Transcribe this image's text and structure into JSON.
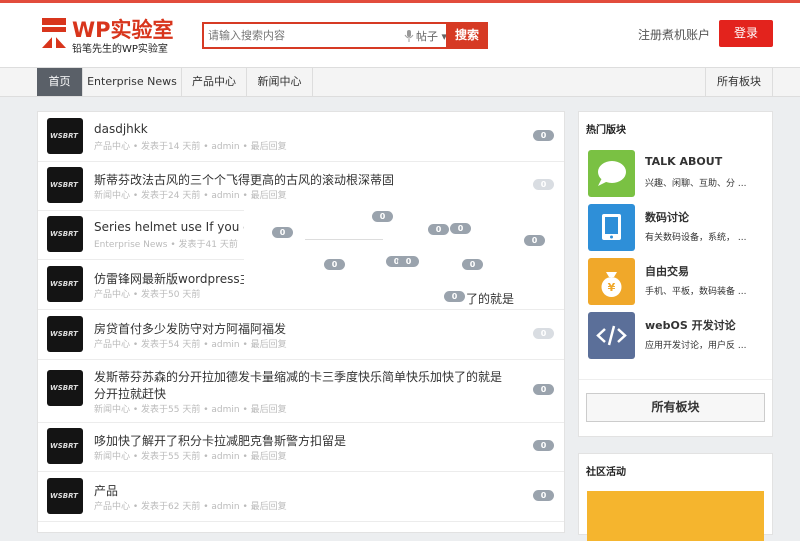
{
  "header": {
    "logo_title": "WP实验室",
    "logo_subtitle": "铅笔先生的WP实验室",
    "search_placeholder": "请输入搜索内容",
    "search_scope": "帖子",
    "search_button": "搜索",
    "register_link": "注册煮机账户",
    "login_button": "登录"
  },
  "nav": {
    "items": [
      "首页",
      "Enterprise News",
      "产品中心",
      "新闻中心"
    ],
    "right": "所有板块"
  },
  "posts": [
    {
      "title": "dasdjhkk",
      "category": "产品中心",
      "time": "发表于14 天前",
      "author": "admin",
      "last": "最后回复",
      "count": "0"
    },
    {
      "title": "斯蒂芬改法古风的三个个飞得更高的古风的滚动根深蒂固",
      "category": "新闻中心",
      "time": "发表于24 天前",
      "author": "admin",
      "last": "最后回复",
      "count": "0"
    },
    {
      "title": "Series helmet use If you do",
      "category": "Enterprise News",
      "time": "发表于41 天前",
      "author": "",
      "last": "",
      "count": ""
    },
    {
      "title": "仿雷锋网最新版wordpress主",
      "category": "产品中心",
      "time": "发表于50 天前",
      "author": "",
      "last": "",
      "count": ""
    },
    {
      "title": "房贷首付多少发防守对方阿福阿福发",
      "category": "产品中心",
      "time": "发表于54 天前",
      "author": "admin",
      "last": "最后回复",
      "count": "0"
    },
    {
      "title": "发斯蒂芬苏森的分开拉加德发卡量缩减的卡三季度快乐简单快乐加快了的就是",
      "title2": "分开拉就赶快",
      "category": "新闻中心",
      "time": "发表于55 天前",
      "author": "admin",
      "last": "最后回复",
      "count": "0"
    },
    {
      "title": "哆加快了解开了积分卡拉减肥克鲁斯警方扣留是",
      "category": "新闻中心",
      "time": "发表于55 天前",
      "author": "admin",
      "last": "最后回复",
      "count": "0"
    },
    {
      "title": "产品",
      "category": "产品中心",
      "time": "发表于62 天前",
      "author": "admin",
      "last": "最后回复",
      "count": "0"
    }
  ],
  "avatar_text": "WSBRT",
  "overlay": {
    "badge": "0",
    "text": "了的就是"
  },
  "sidebar": {
    "hot_title": "热门版块",
    "forums": [
      {
        "name": "TALK ABOUT",
        "desc": "兴趣、闲聊、互助、分 ...",
        "color": "#7ac143",
        "icon": "chat-bubble-icon"
      },
      {
        "name": "数码讨论",
        "desc": "有关数码设备，系统， ...",
        "color": "#2e8fd8",
        "icon": "tablet-icon"
      },
      {
        "name": "自由交易",
        "desc": "手机、平板，数码装备 ...",
        "color": "#f0a82a",
        "icon": "money-bag-icon"
      },
      {
        "name": "webOS 开发讨论",
        "desc": "应用开发讨论，用户反 ...",
        "color": "#5b6f99",
        "icon": "code-icon"
      }
    ],
    "all_boards": "所有板块",
    "community_title": "社区活动"
  },
  "colors": {
    "brand": "#d63a24",
    "login": "#e3231d"
  }
}
